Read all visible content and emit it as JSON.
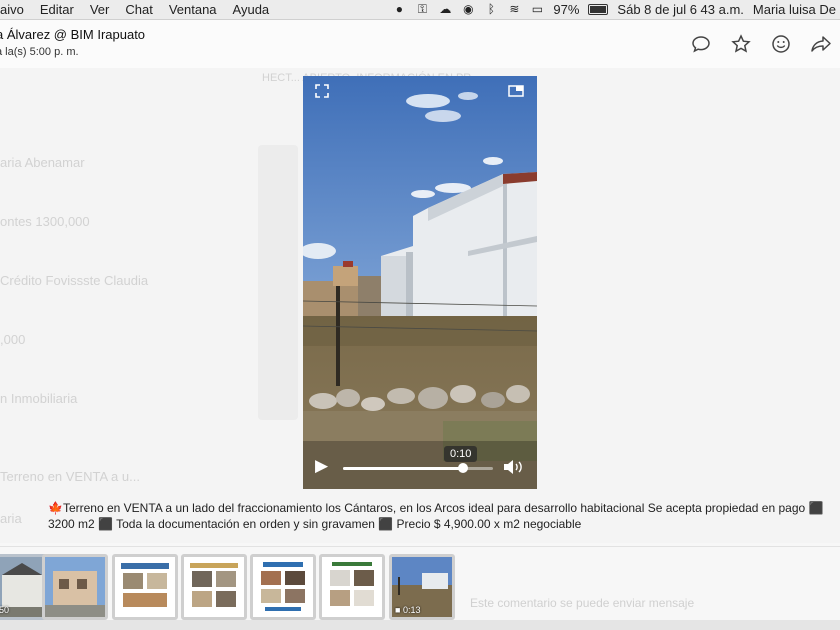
{
  "menubar": {
    "items": [
      "aivo",
      "Editar",
      "Ver",
      "Chat",
      "Ventana",
      "Ayuda"
    ],
    "battery": "97%",
    "datetime": "Sáb 8 de jul  6 43 a.m.",
    "user": "Maria luisa De"
  },
  "header": {
    "title": "a Álvarez @ BIM Irapuato",
    "subtitle": "a la(s) 5:00 p. m.",
    "actions": [
      "chat-bubble-icon",
      "star-icon",
      "smiley-icon",
      "share-icon"
    ]
  },
  "background_ghost": {
    "list": [
      "aria Abenamar",
      "ontes 1300,000",
      "Crédito Fovissste Claudia",
      ",000",
      "n Inmobiliaria",
      "Terreno en VENTA a u...",
      "aria"
    ],
    "heading": "HECT... ABIERTO. INFORMACIÓN EN PR..."
  },
  "video": {
    "time_tooltip": "0:10",
    "progress": 0.8
  },
  "caption": "🍁Terreno en VENTA a un lado del fraccionamiento los Cántaros, en los Arcos ideal para desarrollo habitacional   Se acepta propiedad en pago   ⬛ 3200 m2 ⬛ Toda la documentación en orden y sin gravamen   ⬛ Precio $ 4,900.00 x m2 negociable",
  "thumbnails": [
    {
      "label": "50"
    },
    {
      "label": ""
    },
    {
      "label": ""
    },
    {
      "label": ""
    },
    {
      "label": ""
    },
    {
      "label": ""
    },
    {
      "label": "0:13"
    }
  ],
  "compose_placeholder": "Este comentario se puede enviar mensaje"
}
